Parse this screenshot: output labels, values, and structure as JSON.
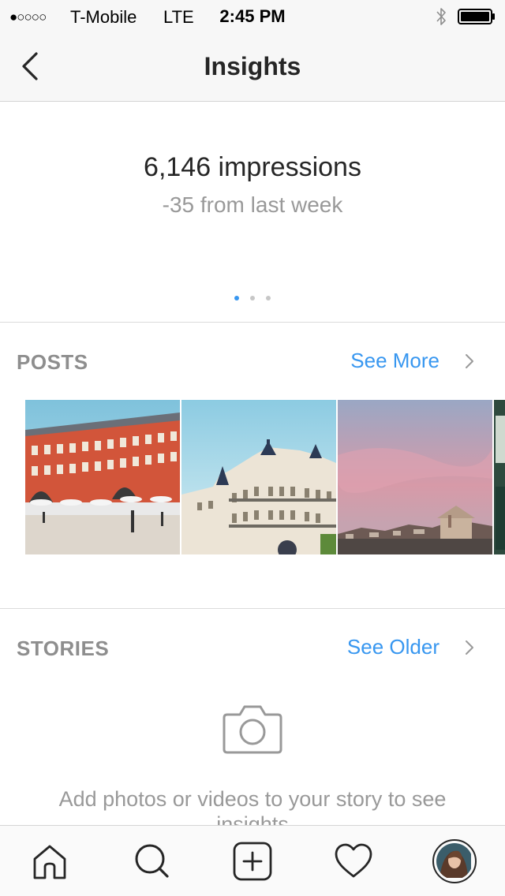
{
  "status_bar": {
    "signal": "●○○○○",
    "carrier": "T-Mobile",
    "network": "LTE",
    "time": "2:45 PM"
  },
  "nav": {
    "title": "Insights"
  },
  "impressions": {
    "count": "6,146 impressions",
    "change": "-35 from last week",
    "page_dots": {
      "total": 3,
      "active": 1
    }
  },
  "posts": {
    "title": "POSTS",
    "link": "See More",
    "thumbnails": [
      "plaza-building",
      "ornate-building",
      "pink-sky-city",
      "partial-thumbnail"
    ]
  },
  "stories": {
    "title": "STORIES",
    "link": "See Older",
    "empty_message": "Add photos or videos to your story to see insights"
  },
  "tab_bar": {
    "items": [
      "home",
      "search",
      "add",
      "activity",
      "profile"
    ]
  },
  "colors": {
    "accent": "#3897f0",
    "muted_text": "#999999",
    "section_header": "#8e8e8e"
  }
}
